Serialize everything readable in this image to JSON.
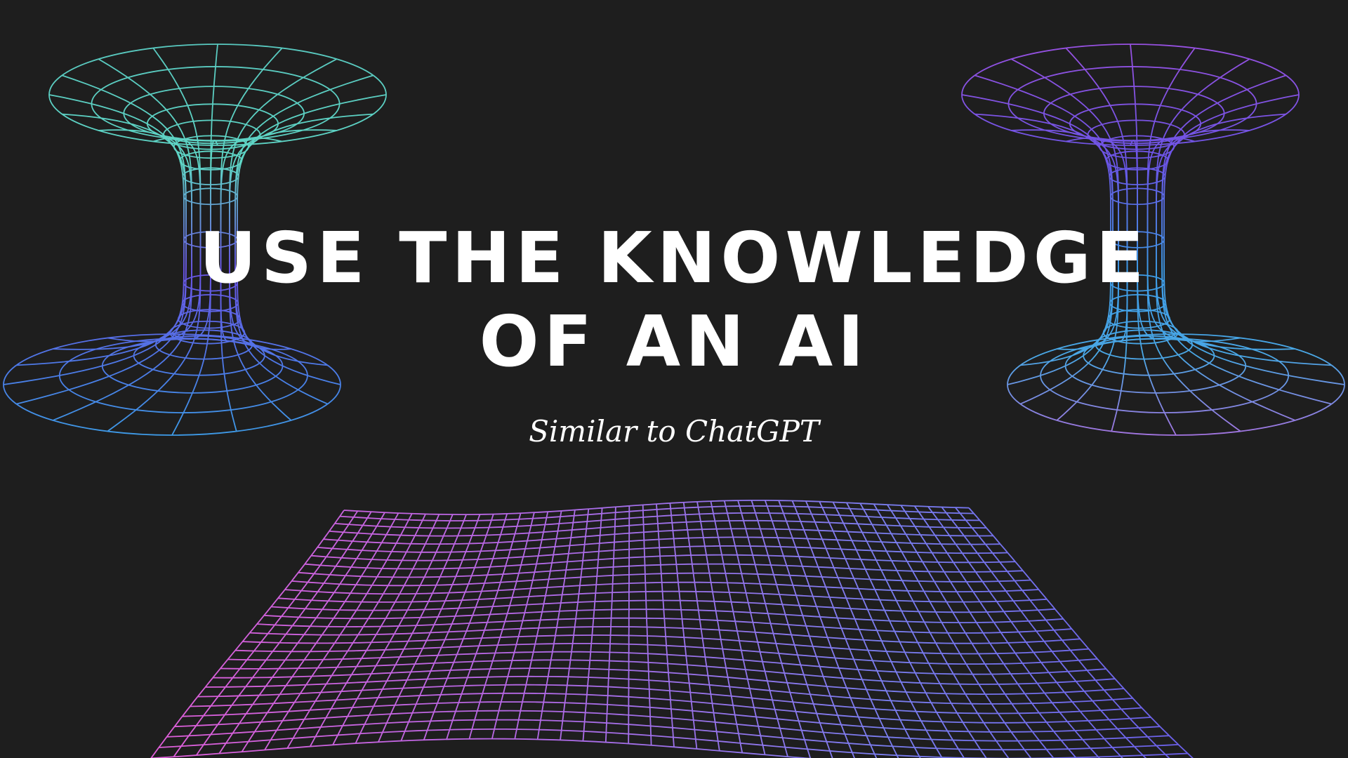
{
  "slide": {
    "title_line_1": "USE THE KNOWLEDGE",
    "title_line_2": "OF AN AI",
    "subtitle": "Similar to ChatGPT"
  },
  "colors": {
    "background": "#1e1e1e",
    "text": "#ffffff",
    "wire_teal": "#5ad0c0",
    "wire_blue": "#3d9ce8",
    "wire_violet": "#6a55e6",
    "wire_purple": "#9b4fd6",
    "wire_pink": "#d060e0"
  },
  "graphics": {
    "left_wormhole": "wireframe-wormhole-icon",
    "right_wormhole": "wireframe-wormhole-icon",
    "floor_grid": "wireframe-grid-plane-icon"
  }
}
